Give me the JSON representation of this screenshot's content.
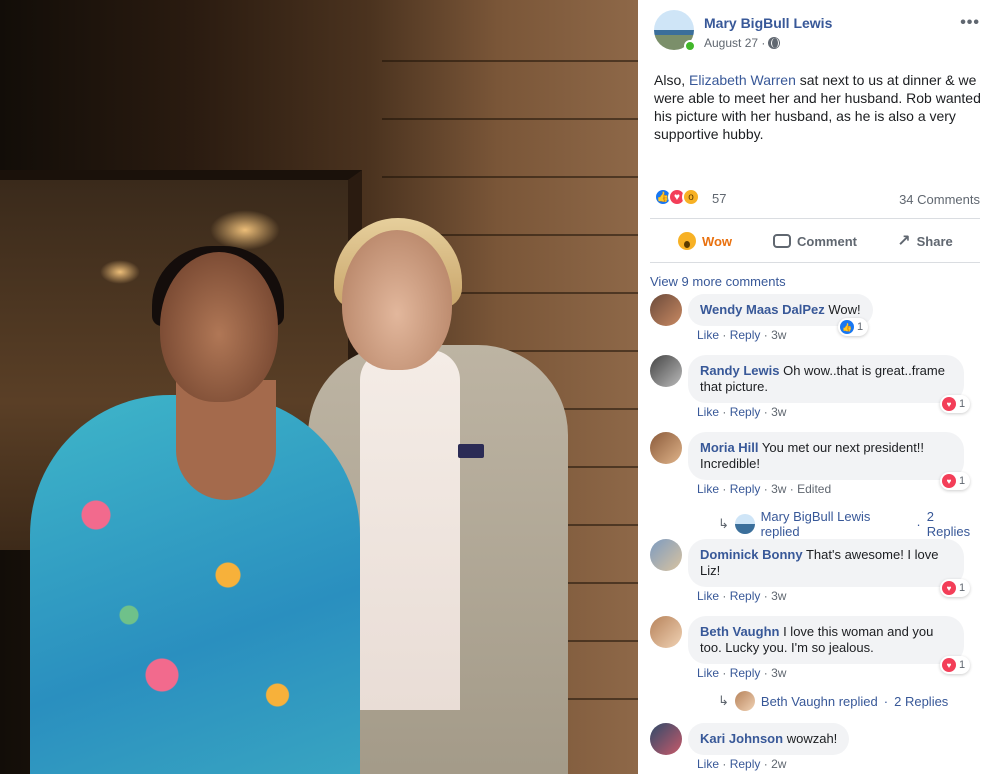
{
  "post": {
    "author": "Mary BigBull Lewis",
    "date": "August 27 ·",
    "privacy_icon": "globe-icon",
    "more_icon": "ellipsis-icon",
    "text_pre": "Also, ",
    "text_link": "Elizabeth Warren",
    "text_post": " sat next to us at dinner & we were able to meet her and her husband. Rob wanted his picture with her husband, as he is also a very supportive hubby.",
    "reaction_count": "57",
    "comment_count": "34 Comments",
    "reaction_icons": [
      "like-icon",
      "love-icon",
      "wow-icon"
    ]
  },
  "actions": {
    "wow": "Wow",
    "comment": "Comment",
    "share": "Share"
  },
  "view_more": "View 9 more comments",
  "comments": [
    {
      "name": "Wendy Maas DalPez",
      "text": "Wow!",
      "like": "Like",
      "reply": "Reply",
      "time": "3w",
      "badge": "1",
      "badge_type": "like"
    },
    {
      "name": "Randy Lewis",
      "text": "Oh wow..that is great..frame that picture.",
      "like": "Like",
      "reply": "Reply",
      "time": "3w",
      "badge": "1",
      "badge_type": "love"
    },
    {
      "name": "Moria Hill",
      "text": "You met our next president!! Incredible!",
      "like": "Like",
      "reply": "Reply",
      "time": "3w",
      "edited": "Edited",
      "badge": "1",
      "badge_type": "love",
      "replied_by": "Mary BigBull Lewis replied",
      "replies": "2 Replies"
    },
    {
      "name": "Dominick Bonny",
      "text": "That's awesome! I love Liz!",
      "like": "Like",
      "reply": "Reply",
      "time": "3w",
      "badge": "1",
      "badge_type": "love"
    },
    {
      "name": "Beth Vaughn",
      "text": "I love this woman and you too. Lucky you. I'm so jealous.",
      "like": "Like",
      "reply": "Reply",
      "time": "3w",
      "badge": "1",
      "badge_type": "love",
      "replied_by": "Beth Vaughn replied",
      "replies": "2 Replies"
    },
    {
      "name": "Kari Johnson",
      "text": "wowzah!",
      "like": "Like",
      "reply": "Reply",
      "time": "2w"
    }
  ],
  "separator": "·",
  "colors": {
    "link": "#385898",
    "wow_active": "#e9710f",
    "bubble": "#f2f3f5",
    "love": "#f33e58",
    "like": "#1877f2"
  }
}
